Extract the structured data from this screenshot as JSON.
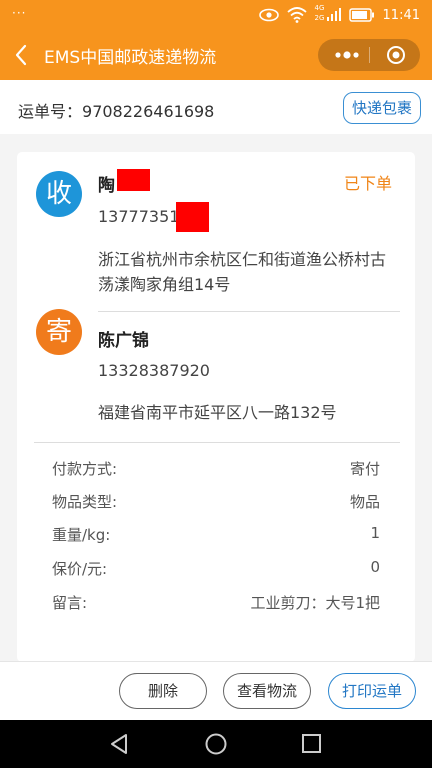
{
  "status_bar": {
    "left": "···",
    "time": "11:41",
    "network": "4G",
    "network2": "2G"
  },
  "nav": {
    "title": "EMS中国邮政速递物流"
  },
  "tracking": {
    "label": "运单号：",
    "number": "9708226461698",
    "express_button": "快递包裹"
  },
  "receiver": {
    "avatar": "收",
    "name": "陶",
    "phone": "13777351",
    "address": "浙江省杭州市余杭区仁和街道渔公桥村古荡漾陶家角组14号",
    "status": "已下单"
  },
  "sender": {
    "avatar": "寄",
    "name": "陈广锦",
    "phone": "13328387920",
    "address": "福建省南平市延平区八一路132号"
  },
  "details": [
    {
      "label": "付款方式:",
      "value": "寄付"
    },
    {
      "label": "物品类型:",
      "value": "物品"
    },
    {
      "label": "重量/kg:",
      "value": "1"
    },
    {
      "label": "保价/元:",
      "value": "0"
    },
    {
      "label": "留言:",
      "value": "工业剪刀：大号1把"
    }
  ],
  "actions": {
    "delete": "删除",
    "track": "查看物流",
    "print": "打印运单"
  },
  "colors": {
    "brand": "#f7941d",
    "blue": "#1e95d9",
    "orange": "#f07b1c",
    "status": "#f08518",
    "redaction": "#ff0000"
  }
}
